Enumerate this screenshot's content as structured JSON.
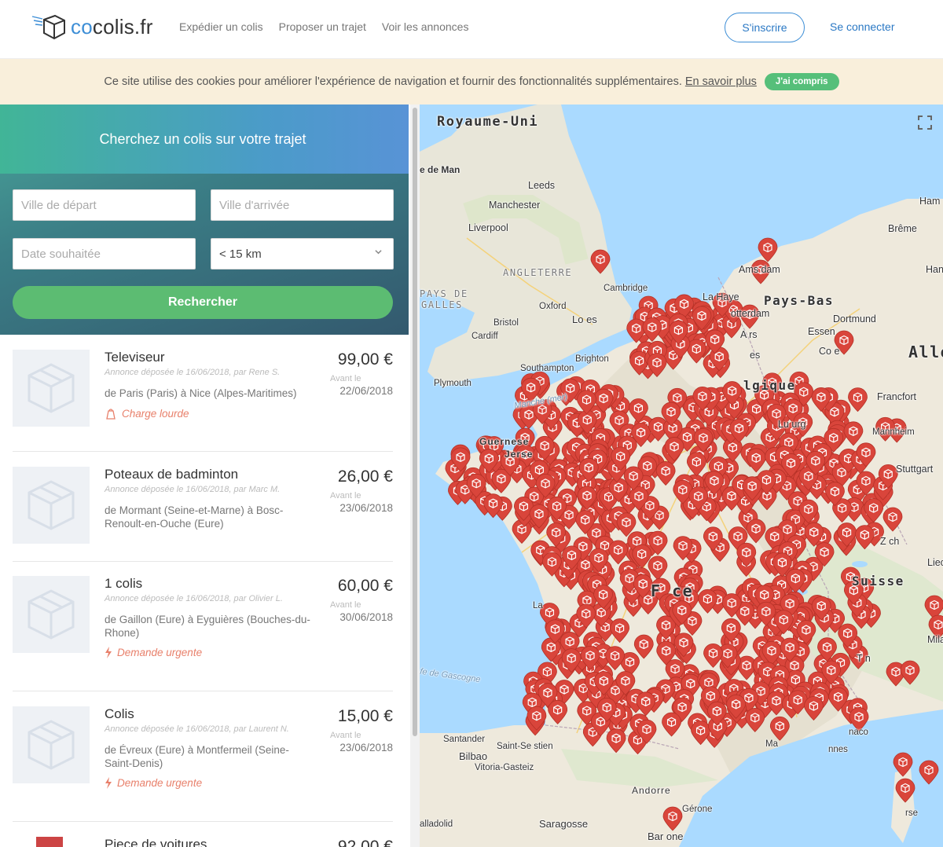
{
  "header": {
    "logo_co": "co",
    "logo_rest": "colis.fr",
    "nav": [
      "Expédier un colis",
      "Proposer un trajet",
      "Voir les annonces"
    ],
    "signup": "S'inscrire",
    "login": "Se connecter"
  },
  "cookie": {
    "text": "Ce site utilise des cookies pour améliorer l'expérience de navigation et fournir des fonctionnalités supplémentaires.",
    "more": "En savoir plus",
    "ok": "J'ai compris"
  },
  "search": {
    "title": "Cherchez un colis sur votre trajet",
    "departure_placeholder": "Ville de départ",
    "arrival_placeholder": "Ville d'arrivée",
    "date_placeholder": "Date souhaitée",
    "radius": "< 15 km",
    "button": "Rechercher"
  },
  "listings": [
    {
      "title": "Televiseur",
      "meta": "Annonce déposée le 16/06/2018, par Rene S.",
      "route": "de Paris (Paris) à Nice (Alpes-Maritimes)",
      "tag": "Charge lourde",
      "tag_icon": "weight-icon",
      "price": "99,00 €",
      "before": "Avant le",
      "date": "22/06/2018"
    },
    {
      "title": "Poteaux de badminton",
      "meta": "Annonce déposée le 16/06/2018, par Marc M.",
      "route": "de Mormant (Seine-et-Marne) à Bosc-Renoult-en-Ouche (Eure)",
      "tag": "",
      "tag_icon": "",
      "price": "26,00 €",
      "before": "Avant le",
      "date": "23/06/2018"
    },
    {
      "title": "1 colis",
      "meta": "Annonce déposée le 16/06/2018, par Olivier L.",
      "route": "de Gaillon (Eure) à Eyguières (Bouches-du-Rhone)",
      "tag": "Demande urgente",
      "tag_icon": "lightning-icon",
      "price": "60,00 €",
      "before": "Avant le",
      "date": "30/06/2018"
    },
    {
      "title": "Colis",
      "meta": "Annonce déposée le 16/06/2018, par Laurent N.",
      "route": "de Évreux (Eure) à Montfermeil (Seine-Saint-Denis)",
      "tag": "Demande urgente",
      "tag_icon": "lightning-icon",
      "price": "15,00 €",
      "before": "Avant le",
      "date": "23/06/2018"
    },
    {
      "title": "Piece de voitures",
      "meta": "",
      "route": "",
      "tag": "",
      "tag_icon": "",
      "price": "92,00 €",
      "before": "",
      "date": ""
    }
  ],
  "map": {
    "labels": {
      "royaume_uni": "Royaume-Uni",
      "ile_de_man": "e de Man",
      "leeds": "Leeds",
      "manchester": "Manchester",
      "liverpool": "Liverpool",
      "angleterre": "ANGLETERRE",
      "cambridge": "Cambridge",
      "pays_de_galles_1": "PAYS DE",
      "pays_de_galles_2": "GALLES",
      "oxford": "Oxford",
      "londres": "Lo    es",
      "bristol": "Bristol",
      "cardiff": "Cardiff",
      "brighton": "Brighton",
      "southampton": "Southampton",
      "plymouth": "Plymouth",
      "manche": "Manche (mer)",
      "guernesey": "Guernese",
      "jersey": "Jerse",
      "amsterdam": "Ams    dam",
      "la_haye": "La Haye",
      "pays_bas": "Pays-Bas",
      "rotterdam": "otterdam",
      "dortmund": "Dortmund",
      "essen": "Essen",
      "cologne": "Co     e",
      "anvers": "A    rs",
      "bruxelles": "   es",
      "belgique": "lgique",
      "allemagne": "Alle",
      "hambourg": "Ham",
      "breme": "Brême",
      "hanovre": "Hano",
      "francfort": "Francfort",
      "mannheim": "Mannheim",
      "stuttgart": "Stuttgart",
      "luxembourg": "Lu          urg",
      "zurich": "Z    ch",
      "liechtenstein": "Liec",
      "suisse": "Suisse",
      "france": "F   ce",
      "la_rochelle": "La",
      "lyon": "  ",
      "milan": "Mila",
      "turin": "T    n",
      "golfe_gascogne": "fe de Gascogne",
      "santander": "Santander",
      "saint_sebastien": "Saint-Se    stien",
      "bilbao": "Bilbao",
      "vitoria": "Vitoria-Gasteiz",
      "andorre": "Andorre",
      "gerone": "Gérone",
      "saragosse": "Saragosse",
      "barcelone": "Bar      one",
      "valladolid": "alladolid",
      "monaco": "   naco",
      "cannes": "   nnes",
      "corse": "   rse",
      "marseille": "Ma"
    }
  }
}
